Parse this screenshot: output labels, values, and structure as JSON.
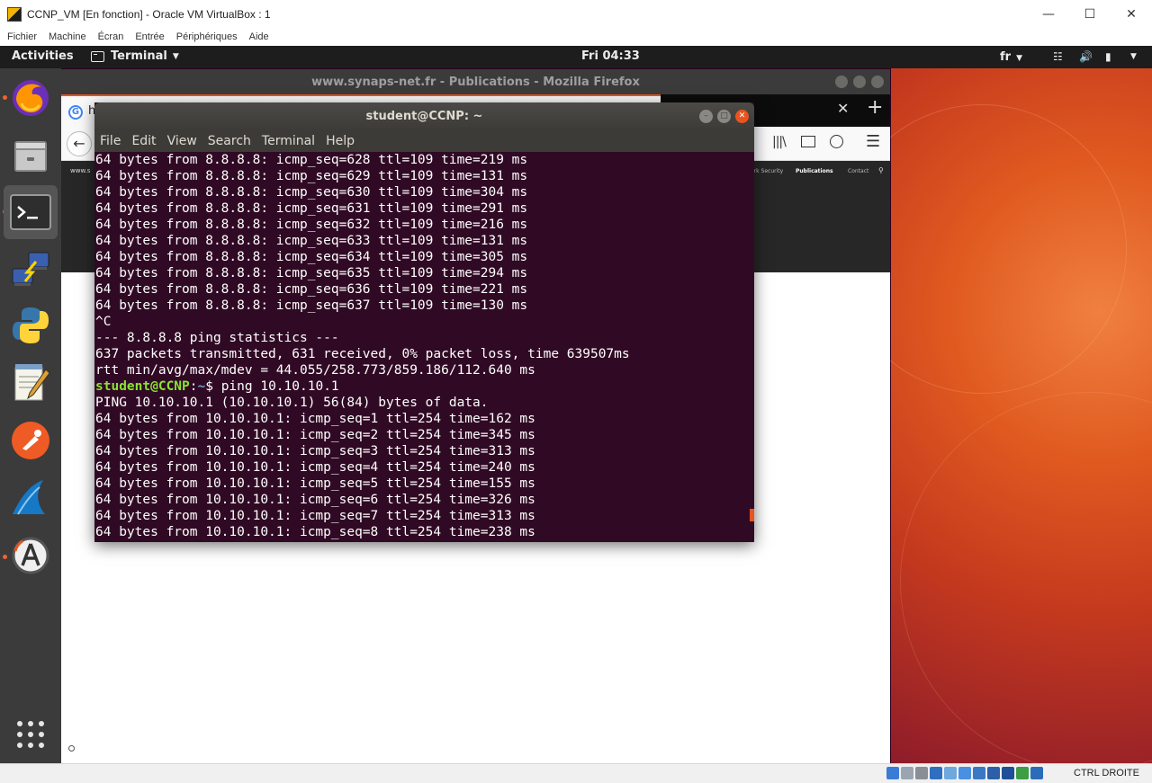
{
  "vbox": {
    "title": "CCNP_VM [En fonction] - Oracle VM VirtualBox : 1",
    "menu": [
      "Fichier",
      "Machine",
      "Écran",
      "Entrée",
      "Périphériques",
      "Aide"
    ],
    "host_key": "CTRL DROITE"
  },
  "topbar": {
    "activities": "Activities",
    "app_name": "Terminal",
    "clock": "Fri 04:33",
    "lang": "fr"
  },
  "dock": {
    "items": [
      "firefox-icon",
      "files-icon",
      "terminal-icon",
      "network-tool-icon",
      "python-icon",
      "text-editor-icon",
      "postman-icon",
      "wireshark-icon",
      "software-updater-icon"
    ],
    "show_apps": "show-applications-icon"
  },
  "firefox": {
    "title": "www.synaps-net.fr - Publications - Mozilla Firefox",
    "tab_letter": "h",
    "site_nav": [
      "ork Security",
      "Publications",
      "Contact"
    ]
  },
  "terminal": {
    "title": "student@CCNP: ~",
    "menu": [
      "File",
      "Edit",
      "View",
      "Search",
      "Terminal",
      "Help"
    ],
    "prompt_user": "student@CCNP",
    "prompt_path": "~",
    "command": "ping 10.10.10.1",
    "lines": [
      "64 bytes from 8.8.8.8: icmp_seq=628 ttl=109 time=219 ms",
      "64 bytes from 8.8.8.8: icmp_seq=629 ttl=109 time=131 ms",
      "64 bytes from 8.8.8.8: icmp_seq=630 ttl=109 time=304 ms",
      "64 bytes from 8.8.8.8: icmp_seq=631 ttl=109 time=291 ms",
      "64 bytes from 8.8.8.8: icmp_seq=632 ttl=109 time=216 ms",
      "64 bytes from 8.8.8.8: icmp_seq=633 ttl=109 time=131 ms",
      "64 bytes from 8.8.8.8: icmp_seq=634 ttl=109 time=305 ms",
      "64 bytes from 8.8.8.8: icmp_seq=635 ttl=109 time=294 ms",
      "64 bytes from 8.8.8.8: icmp_seq=636 ttl=109 time=221 ms",
      "64 bytes from 8.8.8.8: icmp_seq=637 ttl=109 time=130 ms",
      "^C",
      "--- 8.8.8.8 ping statistics ---",
      "637 packets transmitted, 631 received, 0% packet loss, time 639507ms",
      "rtt min/avg/max/mdev = 44.055/258.773/859.186/112.640 ms"
    ],
    "lines_after": [
      "PING 10.10.10.1 (10.10.10.1) 56(84) bytes of data.",
      "64 bytes from 10.10.10.1: icmp_seq=1 ttl=254 time=162 ms",
      "64 bytes from 10.10.10.1: icmp_seq=2 ttl=254 time=345 ms",
      "64 bytes from 10.10.10.1: icmp_seq=3 ttl=254 time=313 ms",
      "64 bytes from 10.10.10.1: icmp_seq=4 ttl=254 time=240 ms",
      "64 bytes from 10.10.10.1: icmp_seq=5 ttl=254 time=155 ms",
      "64 bytes from 10.10.10.1: icmp_seq=6 ttl=254 time=326 ms",
      "64 bytes from 10.10.10.1: icmp_seq=7 ttl=254 time=313 ms",
      "64 bytes from 10.10.10.1: icmp_seq=8 ttl=254 time=238 ms"
    ]
  },
  "colors": {
    "terminal_bg": "#300a24",
    "prompt_user": "#8ae234",
    "prompt_path": "#729fcf",
    "ubuntu_orange": "#e95420"
  }
}
